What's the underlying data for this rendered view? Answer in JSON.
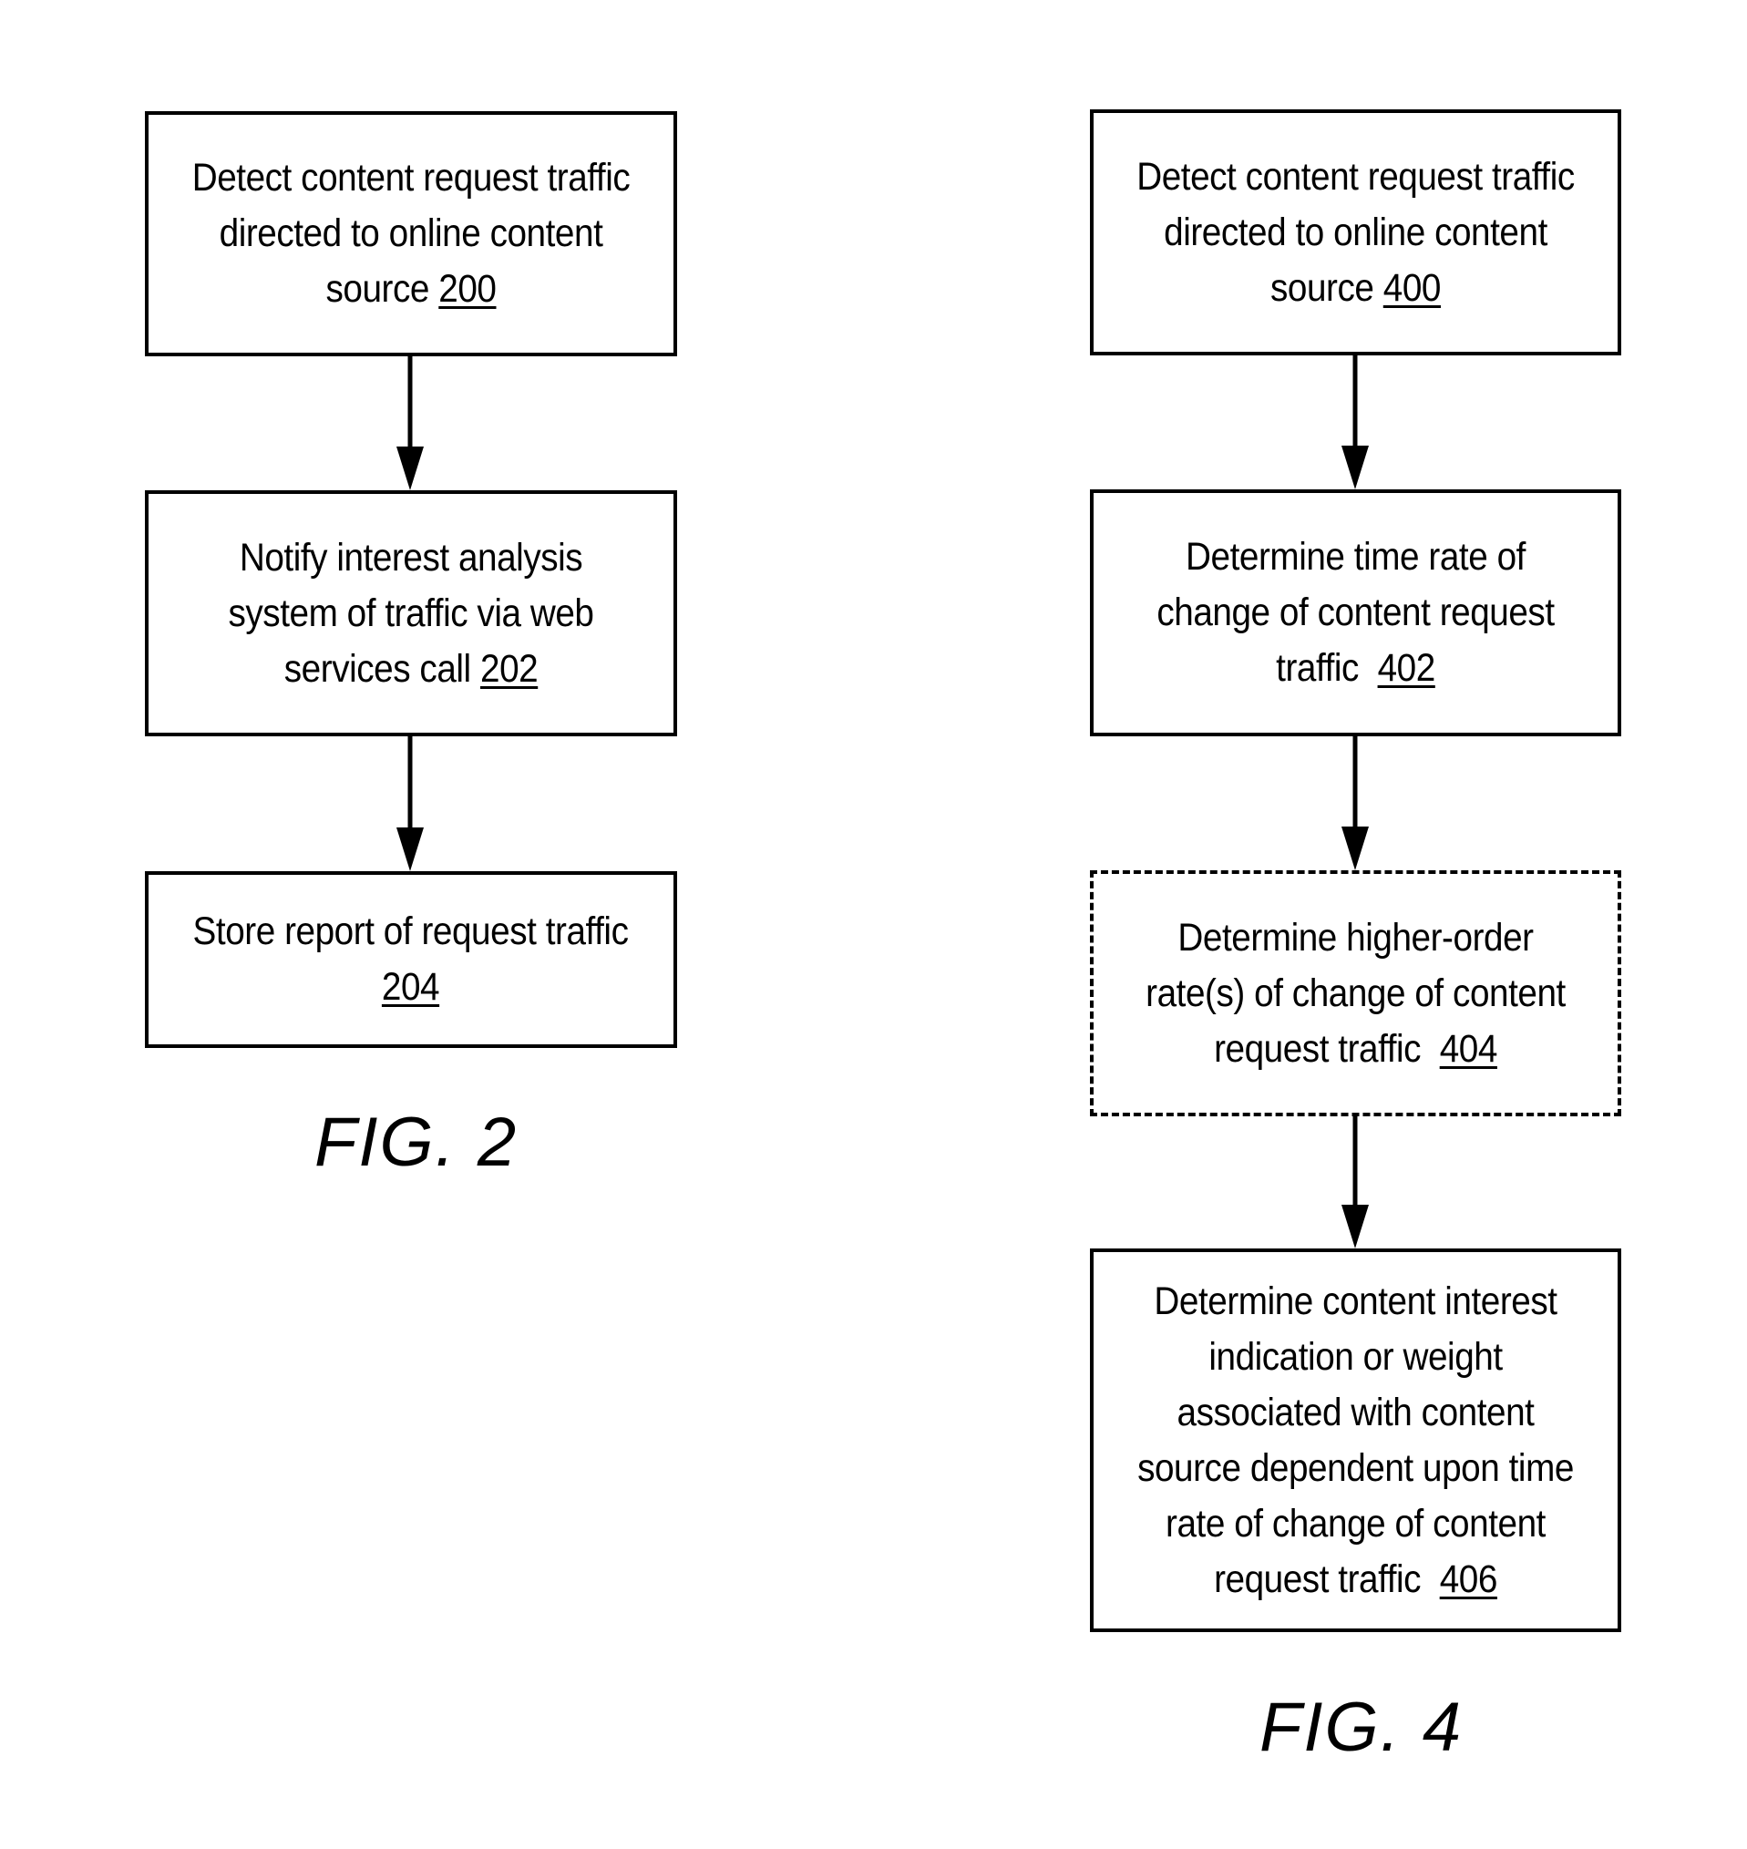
{
  "figures": [
    {
      "caption": "FIG. 2",
      "steps": [
        {
          "text": "Detect content request traffic directed to online content source",
          "ref": "200",
          "style": "solid"
        },
        {
          "text": "Notify interest analysis system of traffic via web services call",
          "ref": "202",
          "style": "solid"
        },
        {
          "text": "Store report of request traffic",
          "ref": "204",
          "style": "solid"
        }
      ]
    },
    {
      "caption": "FIG. 4",
      "steps": [
        {
          "text": "Detect content request traffic directed to online content source",
          "ref": "400",
          "style": "solid"
        },
        {
          "text": "Determine time rate of change of content request traffic",
          "ref": "402",
          "style": "solid"
        },
        {
          "text": "Determine higher-order rate(s) of change of content request traffic",
          "ref": "404",
          "style": "dashed (optional)"
        },
        {
          "text": "Determine content interest indication or weight associated with content source dependent upon time rate of change of content request traffic",
          "ref": "406",
          "style": "solid"
        }
      ]
    }
  ]
}
